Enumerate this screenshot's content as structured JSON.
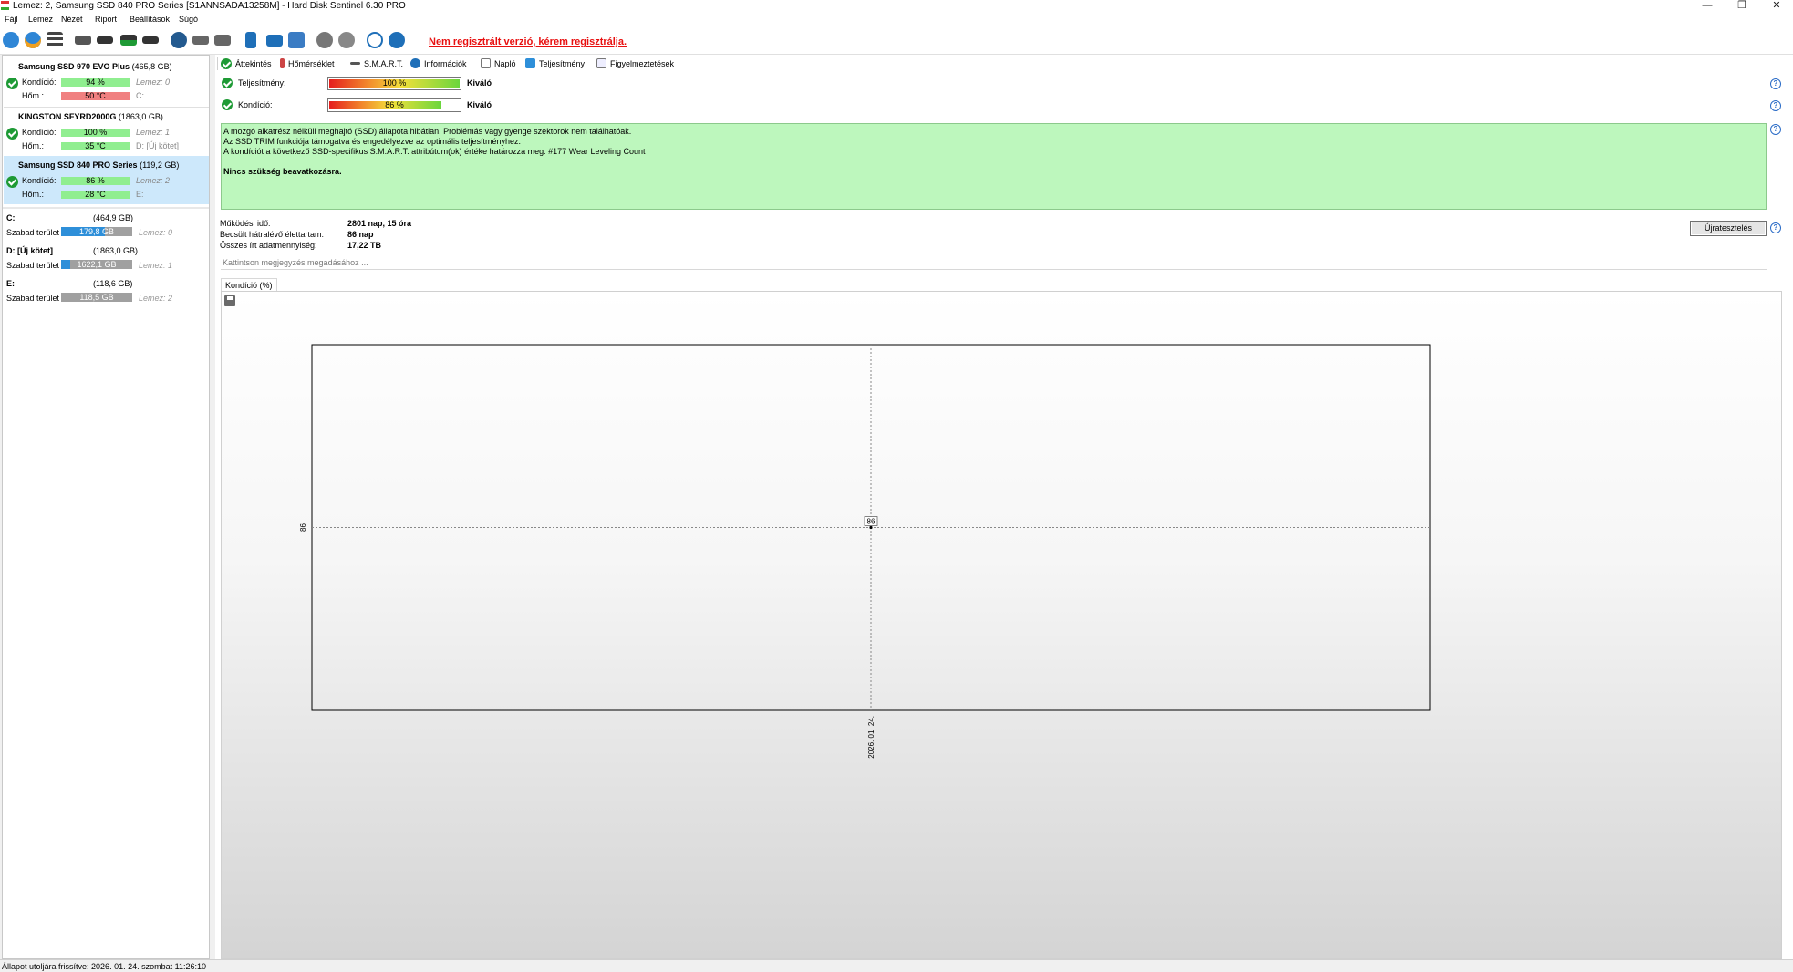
{
  "window": {
    "title": "Lemez: 2, Samsung SSD 840 PRO Series [S1ANNSADA13258M]  -  Hard Disk Sentinel 6.30 PRO",
    "min_glyph": "—",
    "max_glyph": "❐",
    "close_glyph": "✕"
  },
  "menu": [
    "Fájl",
    "Lemez",
    "Nézet",
    "Riport",
    "Beállítások",
    "Súgó"
  ],
  "toolbar": {
    "icons": [
      "refresh-icon",
      "refresh-all-icon",
      "disk-list-icon",
      "disk-tool-icon",
      "disk-remove-icon",
      "disk-ok-icon",
      "disk-eject-icon",
      "network-disk-icon",
      "usb-disk-icon",
      "print-icon",
      "report-icon",
      "mail-icon",
      "web-icon",
      "settings-icon",
      "options-icon",
      "help-icon",
      "info-icon"
    ],
    "not_registered": "Nem regisztrált verzió, kérem regisztrálja."
  },
  "disks": [
    {
      "name": "Samsung SSD 970 EVO Plus",
      "size": "(465,8 GB)",
      "health_label": "Kondíció:",
      "health": "94 %",
      "health_pct": 94,
      "temp_label": "Hőm.:",
      "temp": "50 °C",
      "temp_color": "#f08080",
      "side1": "Lemez: 0",
      "side2": "C:"
    },
    {
      "name": "KINGSTON SFYRD2000G",
      "size": "(1863,0 GB)",
      "health_label": "Kondíció:",
      "health": "100 %",
      "health_pct": 100,
      "temp_label": "Hőm.:",
      "temp": "35 °C",
      "temp_color": "#90ee90",
      "side1": "Lemez: 1",
      "side2": "D: [Új kötet]"
    },
    {
      "name": "Samsung SSD 840 PRO Series",
      "size": "(119,2 GB)",
      "health_label": "Kondíció:",
      "health": "86 %",
      "health_pct": 86,
      "temp_label": "Hőm.:",
      "temp": "28 °C",
      "temp_color": "#90ee90",
      "side1": "Lemez: 2",
      "side2": "E:"
    }
  ],
  "volumes": [
    {
      "name": "C:",
      "size": "(464,9 GB)",
      "free_label": "Szabad terület",
      "free": "179,8 GB",
      "used_fraction": 0.61,
      "disk": "Lemez: 0"
    },
    {
      "name": "D: [Új kötet]",
      "size": "(1863,0 GB)",
      "free_label": "Szabad terület",
      "free": "1622,1 GB",
      "used_fraction": 0.13,
      "disk": "Lemez: 1"
    },
    {
      "name": "E:",
      "size": "(118,6 GB)",
      "free_label": "Szabad terület",
      "free": "118,5 GB",
      "used_fraction": 0.0,
      "disk": "Lemez: 2"
    }
  ],
  "tabs": [
    "Áttekintés",
    "Hőmérséklet",
    "S.M.A.R.T.",
    "Információk",
    "Napló",
    "Teljesítmény",
    "Figyelmeztetések"
  ],
  "overview": {
    "performance": {
      "label": "Teljesítmény:",
      "pct_text": "100 %",
      "pct": 100,
      "rating": "Kiváló"
    },
    "health": {
      "label": "Kondíció:",
      "pct_text": "86 %",
      "pct": 86,
      "rating": "Kiváló"
    },
    "status_lines": [
      "A mozgó alkatrész nélküli meghajtó (SSD) állapota hibátlan. Problémás vagy gyenge szektorok nem találhatóak.",
      "Az SSD TRIM funkciója támogatva és engedélyezve az optimális teljesítményhez.",
      "A kondíciót a következő SSD-specifikus S.M.A.R.T. attribútum(ok) értéke határozza meg:  #177 Wear Leveling Count"
    ],
    "status_bold": "Nincs szükség beavatkozásra.",
    "power_on_label": "Működési idő:",
    "power_on": "2801 nap, 15 óra",
    "remaining_label": "Becsült hátralévő élettartam:",
    "remaining": "86 nap",
    "written_label": "Összes írt adatmennyiség:",
    "written": "17,22 TB",
    "retest_button": "Újratesztelés",
    "note_placeholder": "Kattintson megjegyzés megadásához ..."
  },
  "chart_tab": "Kondíció  (%)",
  "chart_data": {
    "type": "line",
    "title": "",
    "x": [
      "2026. 01. 24."
    ],
    "series": [
      {
        "values": [
          86
        ]
      }
    ],
    "point_labels": [
      "86"
    ],
    "y_tick_labels": [
      "86"
    ],
    "x_tick_labels": [
      "2026. 01. 24."
    ],
    "xlabel": "",
    "ylabel": "",
    "grid": true,
    "legend": "none"
  },
  "statusbar": "Állapot utoljára frissítve: 2026. 01. 24. szombat 11:26:10"
}
